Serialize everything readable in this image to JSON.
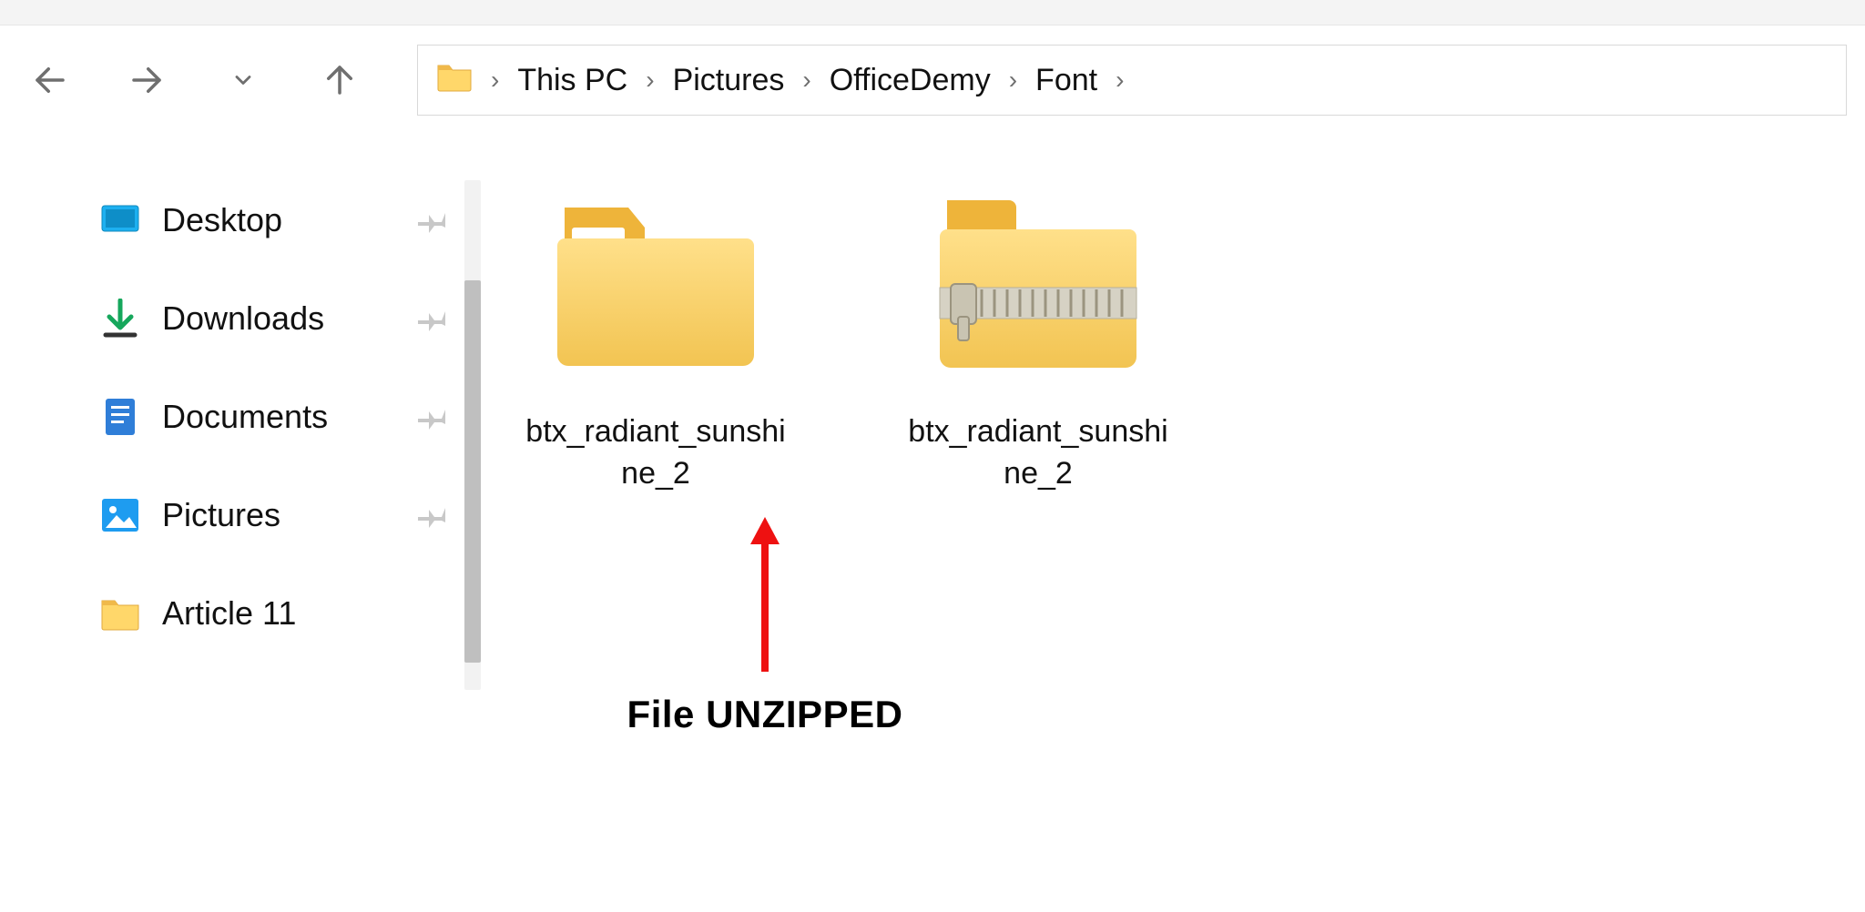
{
  "breadcrumb": {
    "parts": [
      "This PC",
      "Pictures",
      "OfficeDemy",
      "Font"
    ]
  },
  "sidebar": {
    "items": [
      {
        "label": "Desktop",
        "icon": "desktop",
        "pinned": true
      },
      {
        "label": "Downloads",
        "icon": "downloads",
        "pinned": true
      },
      {
        "label": "Documents",
        "icon": "documents",
        "pinned": true
      },
      {
        "label": "Pictures",
        "icon": "pictures",
        "pinned": true
      },
      {
        "label": "Article 11",
        "icon": "folder",
        "pinned": false
      }
    ]
  },
  "content": {
    "items": [
      {
        "label": "btx_radiant_sunshine_2",
        "type": "folder"
      },
      {
        "label": "btx_radiant_sunshine_2",
        "type": "zip-folder"
      }
    ]
  },
  "annotation": {
    "label": "File UNZIPPED"
  }
}
